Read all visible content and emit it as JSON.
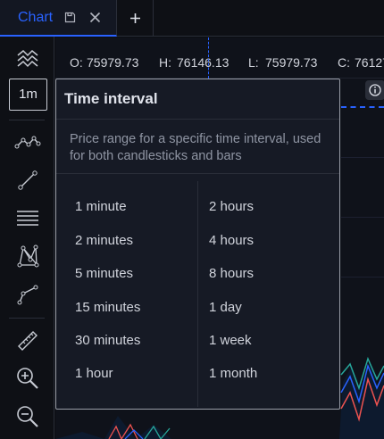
{
  "tab": {
    "title": "Chart"
  },
  "toolbar": {
    "interval_label": "1m"
  },
  "ohlc": {
    "open_label": "O:",
    "open_value": "75979.73",
    "high_label": "H:",
    "high_value": "76146.13",
    "low_label": "L:",
    "low_value": "75979.73",
    "close_label": "C:",
    "close_value": "76127"
  },
  "popup": {
    "title": "Time interval",
    "description": "Price range for a specific time interval, used for both candlesticks and bars",
    "options_left": [
      "1 minute",
      "2 minutes",
      "5 minutes",
      "15 minutes",
      "30 minutes",
      "1 hour"
    ],
    "options_right": [
      "2 hours",
      "4 hours",
      "8 hours",
      "1 day",
      "1 week",
      "1 month"
    ]
  },
  "colors": {
    "accent": "#2962ff",
    "background": "#0b0d12",
    "panel": "#161a25",
    "series_red": "#ef5350",
    "series_green": "#26a69a",
    "series_blue": "#2962ff"
  }
}
